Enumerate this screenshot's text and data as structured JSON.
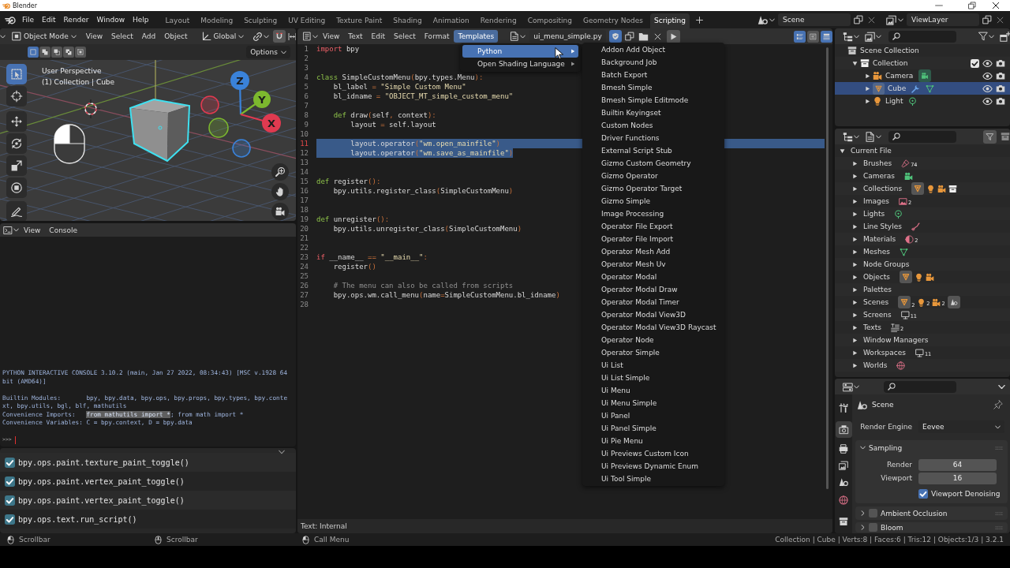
{
  "window": {
    "title": "Blender"
  },
  "top_bar": {
    "menus": [
      "File",
      "Edit",
      "Render",
      "Window",
      "Help"
    ],
    "workspaces": [
      {
        "label": "Layout",
        "selected": false
      },
      {
        "label": "Modeling",
        "selected": false
      },
      {
        "label": "Sculpting",
        "selected": false
      },
      {
        "label": "UV Editing",
        "selected": false
      },
      {
        "label": "Texture Paint",
        "selected": false
      },
      {
        "label": "Shading",
        "selected": false
      },
      {
        "label": "Animation",
        "selected": false
      },
      {
        "label": "Rendering",
        "selected": false
      },
      {
        "label": "Compositing",
        "selected": false
      },
      {
        "label": "Geometry Nodes",
        "selected": false
      },
      {
        "label": "Scripting",
        "selected": true
      }
    ],
    "scene": "Scene",
    "view_layer": "ViewLayer"
  },
  "viewport": {
    "mode": "Object Mode",
    "menus": [
      "View",
      "Select",
      "Add",
      "Object"
    ],
    "orientation": "Global",
    "snapping": true,
    "select_modes": [
      {
        "kind": "new",
        "selected": true
      },
      {
        "kind": "extend",
        "selected": false
      },
      {
        "kind": "subtract",
        "selected": false
      },
      {
        "kind": "invert",
        "selected": false
      },
      {
        "kind": "intersect",
        "selected": false
      }
    ],
    "options": "Options",
    "tools": [
      {
        "kind": "select",
        "selected": true
      },
      {
        "kind": "cursor",
        "selected": false
      },
      {
        "kind": "move",
        "selected": false
      },
      {
        "kind": "rotate",
        "selected": false
      },
      {
        "kind": "scale",
        "selected": false
      },
      {
        "kind": "transform",
        "selected": false
      },
      {
        "kind": "annotate",
        "selected": false
      }
    ],
    "overlay": [
      "User Perspective",
      "(1) Collection | Cube"
    ],
    "gizmo": [
      {
        "label": "Z",
        "color": "#3a82d9"
      },
      {
        "label": "Y",
        "color": "#7cb82e"
      },
      {
        "label": "X",
        "color": "#e03a50"
      }
    ]
  },
  "console": {
    "menus": [
      "View",
      "Console"
    ],
    "blocks": [
      [
        {
          "parts": [
            {
              "text": "PYTHON INTERACTIVE CONSOLE 3.10.2 (main, Jan 27 2022, 08:34:43) [MSC v.1928 64 bit (AMD64)]",
              "selected": false
            }
          ]
        }
      ],
      [
        {
          "parts": [
            {
              "text": "Builtin Modules:       bpy, bpy.data, bpy.ops, bpy.props, bpy.types, bpy.context, bpy.utils, bgl, blf, mathutils",
              "selected": false
            }
          ]
        },
        {
          "parts": [
            {
              "text": "Convenience Imports:   ",
              "selected": false
            },
            {
              "text": "from mathutils import *",
              "selected": true
            },
            {
              "text": "; from math import *",
              "selected": false
            }
          ]
        },
        {
          "parts": [
            {
              "text": "Convenience Variables: C = bpy.context, D = bpy.data",
              "selected": false
            }
          ]
        }
      ]
    ],
    "prompt": ">>>"
  },
  "info_log": [
    {
      "text": "bpy.ops.paint.texture_paint_toggle()",
      "checked": true
    },
    {
      "text": "bpy.ops.paint.vertex_paint_toggle()",
      "checked": true
    },
    {
      "text": "bpy.ops.paint.vertex_paint_toggle()",
      "checked": true
    },
    {
      "text": "bpy.ops.text.run_script()",
      "checked": true
    }
  ],
  "text_editor": {
    "menus": [
      {
        "label": "View",
        "selected": false
      },
      {
        "label": "Text",
        "selected": false
      },
      {
        "label": "Edit",
        "selected": false
      },
      {
        "label": "Select",
        "selected": false
      },
      {
        "label": "Format",
        "selected": false
      },
      {
        "label": "Templates",
        "selected": true
      }
    ],
    "file_name": "ui_menu_simple.py",
    "shield_on": true,
    "toggles": [
      {
        "kind": "line-numbers",
        "on": true
      },
      {
        "kind": "word-wrap",
        "on": false
      },
      {
        "kind": "syntax",
        "on": true
      }
    ],
    "lines": [
      {
        "number": "1",
        "selected": false,
        "current": false,
        "parts": [
          {
            "kind": "keyword",
            "text": "import"
          },
          {
            "kind": "plain",
            "text": " bpy"
          }
        ]
      },
      {
        "number": "2",
        "selected": false,
        "current": false
      },
      {
        "number": "3",
        "selected": false,
        "current": false
      },
      {
        "number": "4",
        "selected": false,
        "current": false,
        "parts": [
          {
            "kind": "definition",
            "text": "class"
          },
          {
            "kind": "plain",
            "text": " SimpleCustomMenu"
          },
          {
            "kind": "punctuation",
            "text": "("
          },
          {
            "kind": "plain",
            "text": "bpy.types.Menu"
          },
          {
            "kind": "punctuation",
            "text": "):"
          }
        ]
      },
      {
        "number": "5",
        "selected": false,
        "current": false,
        "parts": [
          {
            "kind": "plain",
            "text": "    bl_label "
          },
          {
            "kind": "punctuation",
            "text": "= "
          },
          {
            "kind": "string",
            "text": "\"Simple Custom Menu\""
          }
        ]
      },
      {
        "number": "6",
        "selected": false,
        "current": false,
        "parts": [
          {
            "kind": "plain",
            "text": "    bl_idname "
          },
          {
            "kind": "punctuation",
            "text": "= "
          },
          {
            "kind": "string",
            "text": "\"OBJECT_MT_simple_custom_menu\""
          }
        ]
      },
      {
        "number": "7",
        "selected": false,
        "current": false
      },
      {
        "number": "8",
        "selected": false,
        "current": false,
        "parts": [
          {
            "kind": "definition",
            "text": "    def"
          },
          {
            "kind": "plain",
            "text": " draw"
          },
          {
            "kind": "punctuation",
            "text": "("
          },
          {
            "kind": "plain",
            "text": "self"
          },
          {
            "kind": "punctuation",
            "text": ","
          },
          {
            "kind": "plain",
            "text": " context"
          },
          {
            "kind": "punctuation",
            "text": "):"
          }
        ]
      },
      {
        "number": "9",
        "selected": false,
        "current": false,
        "parts": [
          {
            "kind": "plain",
            "text": "        layout "
          },
          {
            "kind": "punctuation",
            "text": "="
          },
          {
            "kind": "plain",
            "text": " self.layout"
          }
        ]
      },
      {
        "number": "10",
        "selected": false,
        "current": false
      },
      {
        "number": "11",
        "selected": true,
        "current": true,
        "parts": [
          {
            "kind": "plain",
            "text": "        layout.operator"
          },
          {
            "kind": "punctuation",
            "text": "("
          },
          {
            "kind": "string",
            "text": "\"wm.open_mainfile\""
          },
          {
            "kind": "punctuation",
            "text": ")"
          }
        ]
      },
      {
        "number": "12",
        "selected": true,
        "current": false,
        "parts": [
          {
            "kind": "plain",
            "text": "        layout.operator"
          },
          {
            "kind": "punctuation",
            "text": "("
          },
          {
            "kind": "string",
            "text": "\"wm.save_as_mainfile\""
          },
          {
            "kind": "punctuation",
            "text": ")"
          }
        ]
      },
      {
        "number": "13",
        "selected": false,
        "current": false
      },
      {
        "number": "14",
        "selected": false,
        "current": false
      },
      {
        "number": "15",
        "selected": false,
        "current": false,
        "parts": [
          {
            "kind": "definition",
            "text": "def"
          },
          {
            "kind": "plain",
            "text": " register"
          },
          {
            "kind": "punctuation",
            "text": "():"
          }
        ]
      },
      {
        "number": "16",
        "selected": false,
        "current": false,
        "parts": [
          {
            "kind": "plain",
            "text": "    bpy.utils.register_class"
          },
          {
            "kind": "punctuation",
            "text": "("
          },
          {
            "kind": "plain",
            "text": "SimpleCustomMenu"
          },
          {
            "kind": "punctuation",
            "text": ")"
          }
        ]
      },
      {
        "number": "17",
        "selected": false,
        "current": false
      },
      {
        "number": "18",
        "selected": false,
        "current": false
      },
      {
        "number": "19",
        "selected": false,
        "current": false,
        "parts": [
          {
            "kind": "definition",
            "text": "def"
          },
          {
            "kind": "plain",
            "text": " unregister"
          },
          {
            "kind": "punctuation",
            "text": "():"
          }
        ]
      },
      {
        "number": "20",
        "selected": false,
        "current": false,
        "parts": [
          {
            "kind": "plain",
            "text": "    bpy.utils.unregister_class"
          },
          {
            "kind": "punctuation",
            "text": "("
          },
          {
            "kind": "plain",
            "text": "SimpleCustomMenu"
          },
          {
            "kind": "punctuation",
            "text": ")"
          }
        ]
      },
      {
        "number": "21",
        "selected": false,
        "current": false
      },
      {
        "number": "22",
        "selected": false,
        "current": false
      },
      {
        "number": "23",
        "selected": false,
        "current": false,
        "parts": [
          {
            "kind": "keyword",
            "text": "if"
          },
          {
            "kind": "plain",
            "text": " __name__ "
          },
          {
            "kind": "punctuation",
            "text": "== "
          },
          {
            "kind": "string",
            "text": "\"__main__\""
          },
          {
            "kind": "punctuation",
            "text": ":"
          }
        ]
      },
      {
        "number": "24",
        "selected": false,
        "current": false,
        "parts": [
          {
            "kind": "plain",
            "text": "    register"
          },
          {
            "kind": "punctuation",
            "text": "()"
          }
        ]
      },
      {
        "number": "25",
        "selected": false,
        "current": false
      },
      {
        "number": "26",
        "selected": false,
        "current": false,
        "parts": [
          {
            "kind": "comment",
            "text": "    # The menu can also be called from scripts"
          }
        ]
      },
      {
        "number": "27",
        "selected": false,
        "current": false,
        "parts": [
          {
            "kind": "plain",
            "text": "    bpy.ops.wm.call_menu"
          },
          {
            "kind": "punctuation",
            "text": "("
          },
          {
            "kind": "plain",
            "text": "name"
          },
          {
            "kind": "punctuation",
            "text": "="
          },
          {
            "kind": "plain",
            "text": "SimpleCustomMenu.bl_idname"
          },
          {
            "kind": "punctuation",
            "text": ")"
          }
        ]
      },
      {
        "number": "28",
        "selected": false,
        "current": false
      }
    ],
    "footer": "Text: Internal",
    "templates_menu": {
      "items": [
        {
          "label": "Python",
          "selected": true
        },
        {
          "label": "Open Shading Language",
          "selected": false
        }
      ],
      "submenu": [
        "Addon Add Object",
        "Background Job",
        "Batch Export",
        "Bmesh Simple",
        "Bmesh Simple Editmode",
        "Builtin Keyingset",
        "Custom Nodes",
        "Driver Functions",
        "External Script Stub",
        "Gizmo Custom Geometry",
        "Gizmo Operator",
        "Gizmo Operator Target",
        "Gizmo Simple",
        "Image Processing",
        "Operator File Export",
        "Operator File Import",
        "Operator Mesh Add",
        "Operator Mesh Uv",
        "Operator Modal",
        "Operator Modal Draw",
        "Operator Modal Timer",
        "Operator Modal View3D",
        "Operator Modal View3D Raycast",
        "Operator Node",
        "Operator Simple",
        "Ui List",
        "Ui List Simple",
        "Ui Menu",
        "Ui Menu Simple",
        "Ui Panel",
        "Ui Panel Simple",
        "Ui Pie Menu",
        "Ui Previews Custom Icon",
        "Ui Previews Dynamic Enum",
        "Ui Tool Simple"
      ]
    }
  },
  "outliner": {
    "tree": [
      {
        "label": "Scene Collection",
        "kind": "scene-collection",
        "selected": false,
        "children": [
          {
            "label": "Collection",
            "kind": "collection",
            "expanded": true,
            "selected": false,
            "checked": true,
            "visible": true,
            "renderable": true,
            "children": [
              {
                "label": "Camera",
                "kind": "camera",
                "expanded": false,
                "selected": false,
                "visible": true,
                "renderable": true,
                "icons": [
                  {
                    "kind": "camera-data",
                    "active": true
                  }
                ]
              },
              {
                "label": "Cube",
                "kind": "mesh",
                "expanded": false,
                "selected": true,
                "visible": true,
                "renderable": true,
                "icons": [
                  {
                    "kind": "modifier",
                    "active": false
                  },
                  {
                    "kind": "mesh-data",
                    "active": false
                  }
                ]
              },
              {
                "label": "Light",
                "kind": "light",
                "expanded": false,
                "selected": false,
                "visible": true,
                "renderable": true,
                "icons": [
                  {
                    "kind": "light-data",
                    "active": false
                  }
                ]
              }
            ]
          }
        ]
      }
    ]
  },
  "blend_file": {
    "tree": [
      {
        "label": "Current File",
        "expanded": true,
        "children": [
          {
            "label": "Brushes",
            "expanded": false,
            "icons": [
              {
                "kind": "brush",
                "count": "74",
                "active": false
              }
            ]
          },
          {
            "label": "Cameras",
            "expanded": false,
            "icons": [
              {
                "kind": "camera-data",
                "active": false
              }
            ]
          },
          {
            "label": "Collections",
            "expanded": false,
            "icons": [
              {
                "kind": "mesh",
                "active": true
              },
              {
                "kind": "light",
                "active": false
              },
              {
                "kind": "camera",
                "active": false
              },
              {
                "kind": "collection",
                "active": false
              }
            ]
          },
          {
            "label": "Images",
            "expanded": false,
            "icons": [
              {
                "kind": "image",
                "count": "2",
                "active": false
              }
            ]
          },
          {
            "label": "Lights",
            "expanded": false,
            "icons": [
              {
                "kind": "light-data",
                "active": false
              }
            ]
          },
          {
            "label": "Line Styles",
            "expanded": false,
            "icons": [
              {
                "kind": "line-style",
                "active": false
              }
            ]
          },
          {
            "label": "Materials",
            "expanded": false,
            "icons": [
              {
                "kind": "material",
                "count": "2",
                "active": false
              }
            ]
          },
          {
            "label": "Meshes",
            "expanded": false,
            "icons": [
              {
                "kind": "mesh-data",
                "active": false
              }
            ]
          },
          {
            "label": "Node Groups",
            "expanded": false
          },
          {
            "label": "Objects",
            "expanded": false,
            "icons": [
              {
                "kind": "mesh",
                "active": true
              },
              {
                "kind": "light",
                "active": false
              },
              {
                "kind": "camera",
                "active": false
              }
            ]
          },
          {
            "label": "Palettes",
            "expanded": false
          },
          {
            "label": "Scenes",
            "expanded": false,
            "icons": [
              {
                "kind": "mesh",
                "count": "2",
                "active": true
              },
              {
                "kind": "light",
                "count": "2",
                "active": false
              },
              {
                "kind": "camera",
                "count": "2",
                "active": false
              },
              {
                "kind": "scene",
                "active": true
              }
            ]
          },
          {
            "label": "Screens",
            "expanded": false,
            "icons": [
              {
                "kind": "screen",
                "count": "11",
                "active": false
              }
            ]
          },
          {
            "label": "Texts",
            "expanded": false,
            "icons": [
              {
                "kind": "text",
                "count": "2",
                "active": false
              }
            ]
          },
          {
            "label": "Window Managers",
            "expanded": false
          },
          {
            "label": "Workspaces",
            "expanded": false,
            "icons": [
              {
                "kind": "screen",
                "count": "11",
                "active": false
              }
            ]
          },
          {
            "label": "Worlds",
            "expanded": false,
            "icons": [
              {
                "kind": "world",
                "active": false
              }
            ]
          }
        ]
      }
    ]
  },
  "properties": {
    "tabs": [
      {
        "kind": "tool",
        "selected": false
      },
      {
        "kind": "render",
        "selected": true
      },
      {
        "kind": "output",
        "selected": false
      },
      {
        "kind": "view-layer",
        "selected": false
      },
      {
        "kind": "scene",
        "selected": false
      },
      {
        "kind": "world",
        "selected": false
      },
      {
        "kind": "collection",
        "selected": false
      }
    ],
    "context": "Scene",
    "render_engine": {
      "label": "Render Engine",
      "value": "Eevee"
    },
    "panels": [
      {
        "title": "Sampling",
        "expanded": true,
        "rows": [
          {
            "kind": "number",
            "label": "Render",
            "value": "64"
          },
          {
            "kind": "number",
            "label": "Viewport",
            "value": "16"
          },
          {
            "kind": "checkbox",
            "label": "Viewport Denoising",
            "checked": true
          }
        ]
      },
      {
        "title": "Ambient Occlusion",
        "expanded": false,
        "checked": false
      },
      {
        "title": "Bloom",
        "expanded": false,
        "checked": false
      }
    ]
  },
  "status_bar": {
    "hints": [
      {
        "kind": "left",
        "label": "Scrollbar"
      },
      {
        "kind": "middle",
        "label": "Scrollbar"
      },
      {
        "kind": "left",
        "label": "Call Menu"
      }
    ],
    "stats": "Collection | Cube | Verts:8 | Faces:6 | Tris:12 | Objects:1/3 | 3.2.1"
  }
}
